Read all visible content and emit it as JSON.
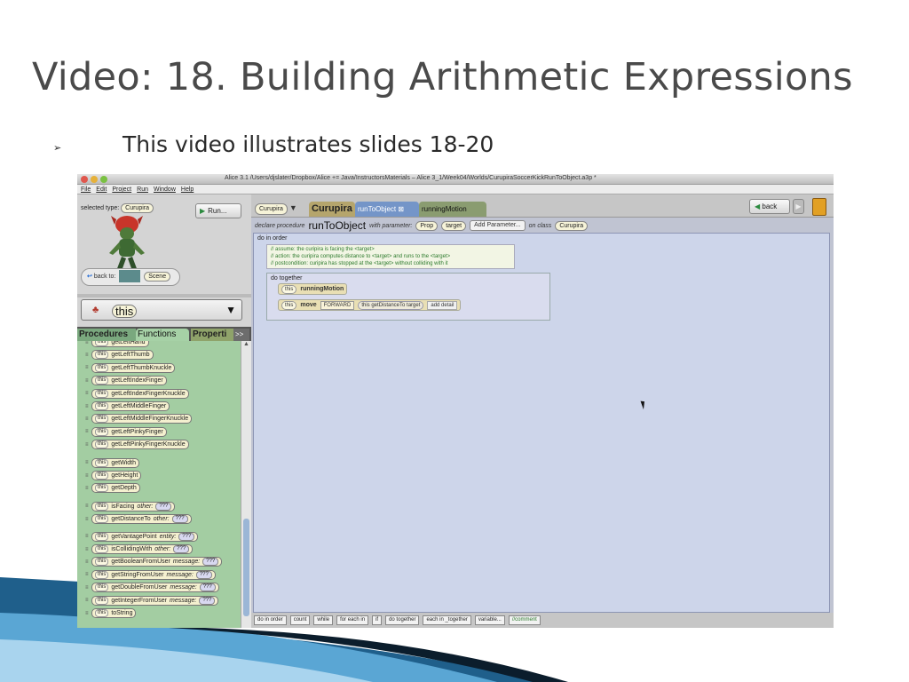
{
  "slide": {
    "title": "Video: 18. Building Arithmetic Expressions",
    "bullet": "This video illustrates slides 18-20",
    "bullet_marker": "➢"
  },
  "window": {
    "title": "Alice  3.1 /Users/djslater/Dropbox/Alice += Java/InstructorsMaterials – Alice 3_1/Week04/Worlds/CurupiraSoccerKickRunToObject.a3p *",
    "menu": [
      "File",
      "Edit",
      "Project",
      "Run",
      "Window",
      "Help"
    ]
  },
  "left_panel": {
    "selected_type_label": "selected type:",
    "selected_type_value": "Curupira",
    "run_label": "Run...",
    "back_to_label": "back to:",
    "scene_label": "Scene",
    "this_value": "this",
    "tabs": {
      "procedures": "Procedures",
      "functions": "Functions",
      "properties": "Properti",
      "more": ">>"
    },
    "this_chip": "this",
    "functions": [
      {
        "name": "getLeftHand",
        "param": "",
        "placeholder": ""
      },
      {
        "name": "getLeftThumb",
        "param": "",
        "placeholder": ""
      },
      {
        "name": "getLeftThumbKnuckle",
        "param": "",
        "placeholder": ""
      },
      {
        "name": "getLeftIndexFinger",
        "param": "",
        "placeholder": ""
      },
      {
        "name": "getLeftIndexFingerKnuckle",
        "param": "",
        "placeholder": ""
      },
      {
        "name": "getLeftMiddleFinger",
        "param": "",
        "placeholder": ""
      },
      {
        "name": "getLeftMiddleFingerKnuckle",
        "param": "",
        "placeholder": ""
      },
      {
        "name": "getLeftPinkyFinger",
        "param": "",
        "placeholder": ""
      },
      {
        "name": "getLeftPinkyFingerKnuckle",
        "param": "",
        "placeholder": ""
      },
      {
        "name": "getWidth",
        "param": "",
        "placeholder": ""
      },
      {
        "name": "getHeight",
        "param": "",
        "placeholder": ""
      },
      {
        "name": "getDepth",
        "param": "",
        "placeholder": ""
      },
      {
        "name": "isFacing",
        "param": "other:",
        "placeholder": "???"
      },
      {
        "name": "getDistanceTo",
        "param": "other:",
        "placeholder": "???"
      },
      {
        "name": "getVantagePoint",
        "param": "entity:",
        "placeholder": "???"
      },
      {
        "name": "isCollidingWith",
        "param": "other:",
        "placeholder": "???"
      },
      {
        "name": "getBooleanFromUser",
        "param": "message:",
        "placeholder": "???"
      },
      {
        "name": "getStringFromUser",
        "param": "message:",
        "placeholder": "???"
      },
      {
        "name": "getDoubleFromUser",
        "param": "message:",
        "placeholder": "???"
      },
      {
        "name": "getIntegerFromUser",
        "param": "message:",
        "placeholder": "???"
      },
      {
        "name": "toString",
        "param": "",
        "placeholder": ""
      }
    ]
  },
  "editor": {
    "object_dropdown": "Curupira",
    "tabs": {
      "class_tab": "Curupira",
      "proc_tab": "runToObject",
      "close_mark": "⊠",
      "motion_tab": "runningMotion"
    },
    "back_label": "back",
    "declare": {
      "prefix": "declare procedure",
      "name": "runToObject",
      "with_param": "with parameter:",
      "param_type": "Prop",
      "param_name": "target",
      "add_param": "Add Parameter...",
      "on_class": "on class",
      "class_name": "Curupira"
    },
    "do_in_order": "do in order",
    "comments": [
      "// assume: the curipira is facing the <target>",
      "// action: the curipira computes distance to <target> and runs to the <target>",
      "// postcondition: curipira has stopped at the <target> without colliding with it"
    ],
    "do_together": "do together",
    "stmt1": {
      "target": "this",
      "proc": "runningMotion"
    },
    "stmt2": {
      "target": "this",
      "proc": "move",
      "direction": "FORWARD",
      "arg_target": "this",
      "fn": "getDistanceTo",
      "fn_arg": "target",
      "add_detail": "add detail"
    },
    "bottom_buttons": [
      "do in order",
      "count",
      "while",
      "for each in",
      "if",
      "do together",
      "each in _together",
      "variable...",
      "//comment"
    ]
  }
}
